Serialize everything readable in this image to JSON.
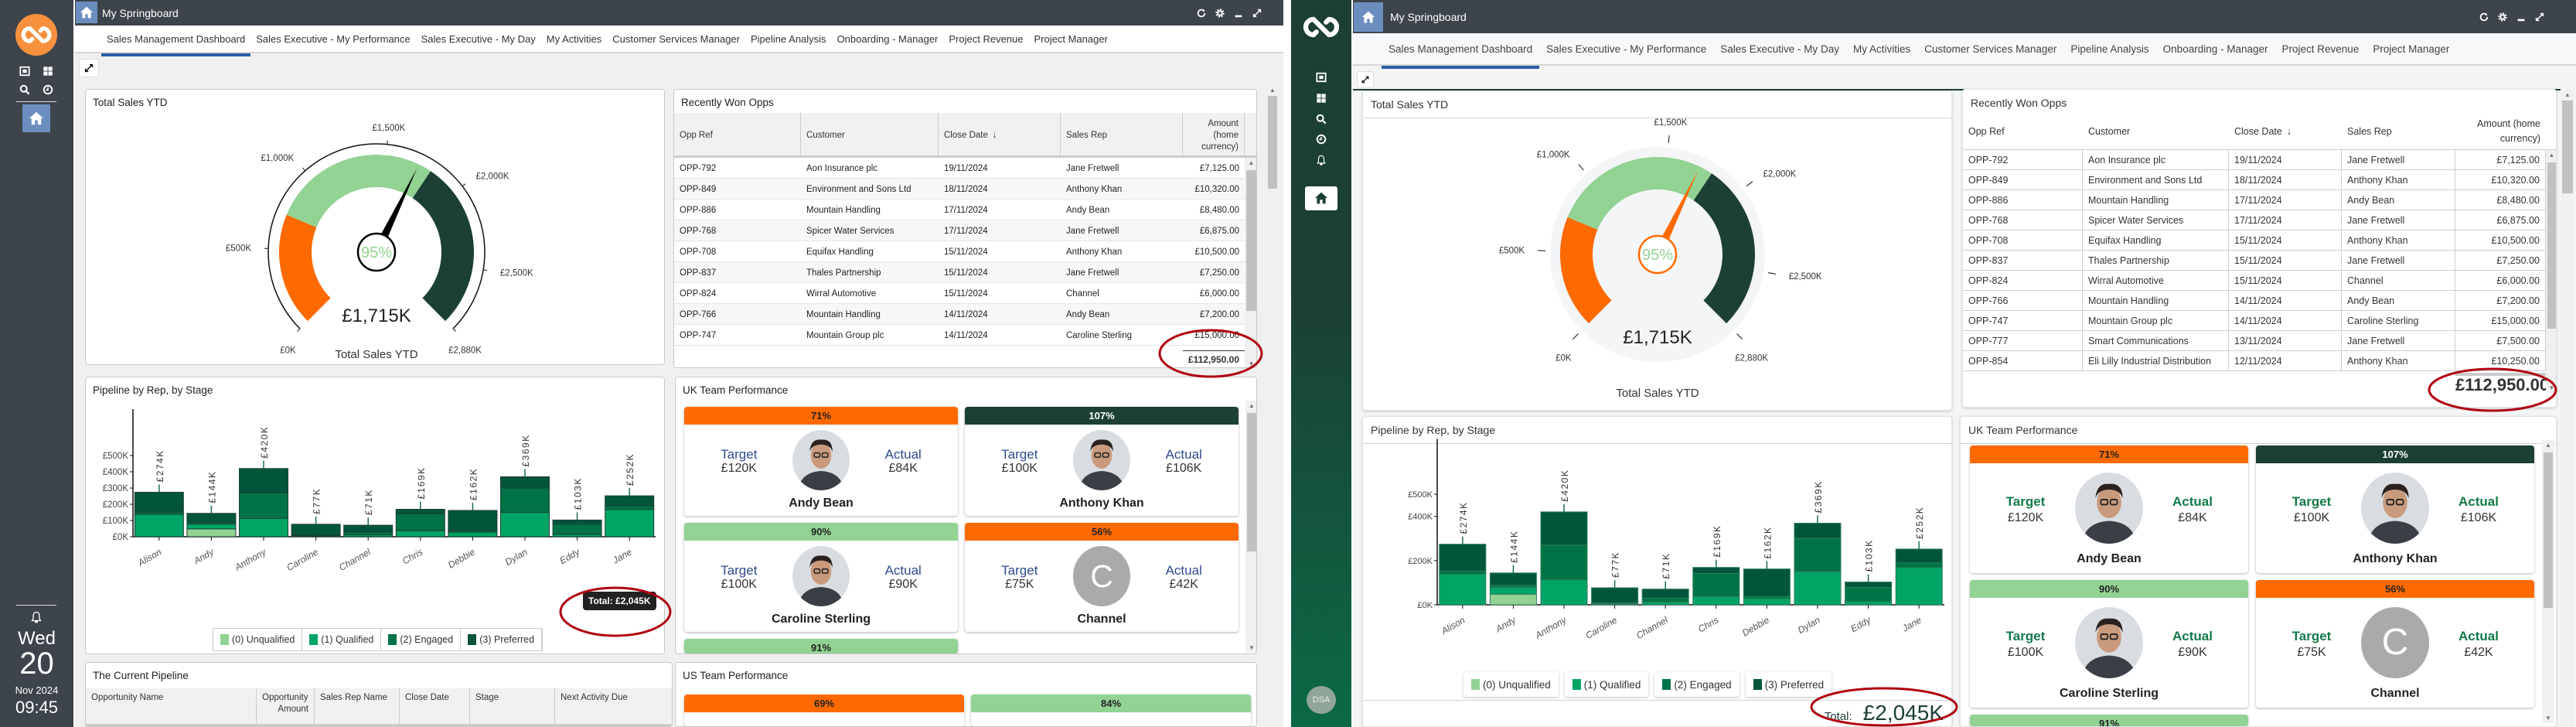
{
  "app": {
    "title": "My Springboard",
    "tabs": [
      "Sales Management Dashboard",
      "Sales Executive - My Performance",
      "Sales Executive - My Day",
      "My Activities",
      "Customer Services Manager",
      "Pipeline Analysis",
      "Onboarding - Manager",
      "Project Revenue",
      "Project Manager"
    ],
    "active_tab": "Sales Management Dashboard"
  },
  "sidebar_classic": {
    "weekday": "Wed",
    "day": "20",
    "month_year": "Nov 2024",
    "time": "09:45"
  },
  "sidebar_modern": {
    "user_initials": "DSA"
  },
  "panels": {
    "total_sales": "Total Sales YTD",
    "recent_won": "Recently Won Opps",
    "pipeline": "Pipeline by Rep, by Stage",
    "uk_team": "UK Team Performance",
    "us_team": "US Team Performance",
    "current_pipeline": "The Current Pipeline"
  },
  "recent_won": {
    "columns": [
      "Opp Ref",
      "Customer",
      "Close Date",
      "Sales Rep",
      "Amount (home currency)"
    ],
    "sort_indicator": "↓",
    "rows": [
      [
        "OPP-792",
        "Aon Insurance plc",
        "19/11/2024",
        "Jane Fretwell",
        "£7,125.00"
      ],
      [
        "OPP-849",
        "Environment and Sons Ltd",
        "18/11/2024",
        "Anthony Khan",
        "£10,320.00"
      ],
      [
        "OPP-886",
        "Mountain Handling",
        "17/11/2024",
        "Andy Bean",
        "£8,480.00"
      ],
      [
        "OPP-768",
        "Spicer Water Services",
        "17/11/2024",
        "Jane Fretwell",
        "£6,875.00"
      ],
      [
        "OPP-708",
        "Equifax Handling",
        "15/11/2024",
        "Anthony Khan",
        "£10,500.00"
      ],
      [
        "OPP-837",
        "Thales Partnership",
        "15/11/2024",
        "Jane Fretwell",
        "£7,250.00"
      ],
      [
        "OPP-824",
        "Wirral Automotive",
        "15/11/2024",
        "Channel",
        "£6,000.00"
      ],
      [
        "OPP-766",
        "Mountain Handling",
        "14/11/2024",
        "Andy Bean",
        "£7,200.00"
      ],
      [
        "OPP-747",
        "Mountain Group plc",
        "14/11/2024",
        "Caroline Sterling",
        "£15,000.00"
      ],
      [
        "OPP-777",
        "Smart Communications",
        "13/11/2024",
        "Jane Fretwell",
        "£7,500.00"
      ],
      [
        "OPP-854",
        "Eli Lilly Industrial Distribution",
        "12/11/2024",
        "Anthony Khan",
        "£10,250.00"
      ]
    ],
    "total": "£112,950.00"
  },
  "current_pipeline": {
    "columns": [
      "Opportunity Name",
      "Opportunity",
      "Amount",
      "Sales Rep Name",
      "Close Date",
      "Stage",
      "Next Activity Due"
    ]
  },
  "uk_team": [
    {
      "pct": "71%",
      "status": "below",
      "name": "Andy Bean",
      "target_label": "Target",
      "target": "£120K",
      "actual_label": "Actual",
      "actual": "£84K",
      "avatar": "photo"
    },
    {
      "pct": "107%",
      "status": "above",
      "name": "Anthony Khan",
      "target_label": "Target",
      "target": "£100K",
      "actual_label": "Actual",
      "actual": "£106K",
      "avatar": "photo"
    },
    {
      "pct": "90%",
      "status": "near",
      "name": "Caroline Sterling",
      "target_label": "Target",
      "target": "£100K",
      "actual_label": "Actual",
      "actual": "£90K",
      "avatar": "photo"
    },
    {
      "pct": "56%",
      "status": "below",
      "name": "Channel",
      "target_label": "Target",
      "target": "£75K",
      "actual_label": "Actual",
      "actual": "£42K",
      "avatar": "initial",
      "initial": "C"
    },
    {
      "pct": "91%",
      "status": "near"
    }
  ],
  "us_team": [
    {
      "pct": "69%",
      "status": "below"
    },
    {
      "pct": "84%",
      "status": "near"
    }
  ],
  "colors": {
    "orange": "#ff6a00",
    "light_green": "#92d293",
    "dark_green": "#1c4033",
    "unqualified": "#92d293",
    "qualified": "#00a565",
    "engaged": "#007346",
    "preferred": "#00553a",
    "tab_underline": "#2a5ea8",
    "annotation": "#b00010"
  },
  "chart_data": [
    {
      "type": "gauge",
      "title": "Total Sales YTD",
      "value": 1715,
      "value_label": "£1,715K",
      "percent_label": "95%",
      "min": 0,
      "max": 2880,
      "ticks": [
        0,
        500,
        1000,
        1500,
        2000,
        2500,
        2880
      ],
      "tick_labels": [
        "£0K",
        "£500K",
        "£1,000K",
        "£1,500K",
        "£2,000K",
        "£2,500K",
        "£2,880K"
      ],
      "bands": [
        {
          "from": 0,
          "to": 720,
          "color": "#ff6a00"
        },
        {
          "from": 720,
          "to": 1800,
          "color": "#92d293"
        },
        {
          "from": 1800,
          "to": 2880,
          "color": "#1c4033"
        }
      ]
    },
    {
      "type": "bar",
      "stacked": true,
      "categories": [
        "Alison",
        "Andy",
        "Anthony",
        "Caroline",
        "Channel",
        "Chris",
        "Debbie",
        "Dylan",
        "Eddy",
        "Jane"
      ],
      "series": [
        {
          "name": "(0) Unqualified",
          "color": "#92d293",
          "values": [
            0,
            48,
            0,
            0,
            0,
            0,
            0,
            0,
            0,
            0
          ]
        },
        {
          "name": "(1) Qualified",
          "color": "#00a565",
          "values": [
            138,
            30,
            113,
            4,
            12,
            37,
            28,
            150,
            15,
            168
          ]
        },
        {
          "name": "(2) Engaged",
          "color": "#007346",
          "values": [
            14,
            10,
            157,
            4,
            18,
            105,
            10,
            150,
            63,
            22
          ]
        },
        {
          "name": "(3) Preferred",
          "color": "#00553a",
          "values": [
            122,
            56,
            150,
            69,
            41,
            27,
            124,
            69,
            25,
            62
          ]
        }
      ],
      "total_labels": [
        "£274K",
        "£144K",
        "£420K",
        "£77K",
        "£71K",
        "£169K",
        "£162K",
        "£369K",
        "£103K",
        "£252K"
      ],
      "ylim": [
        0,
        500
      ],
      "yunit": "K",
      "yticks_classic": [
        "£0K",
        "£100K",
        "£200K",
        "£300K",
        "£400K",
        "£500K"
      ],
      "yticks_modern": [
        "£0K",
        "£200K",
        "£400K",
        "£500K"
      ],
      "ytick_values_classic": [
        0,
        100,
        200,
        300,
        400,
        500
      ],
      "ytick_values_modern": [
        0,
        200,
        400,
        500
      ],
      "legend_position": "bottom",
      "total_prefix": "Total:",
      "total": "£2,045K"
    }
  ]
}
